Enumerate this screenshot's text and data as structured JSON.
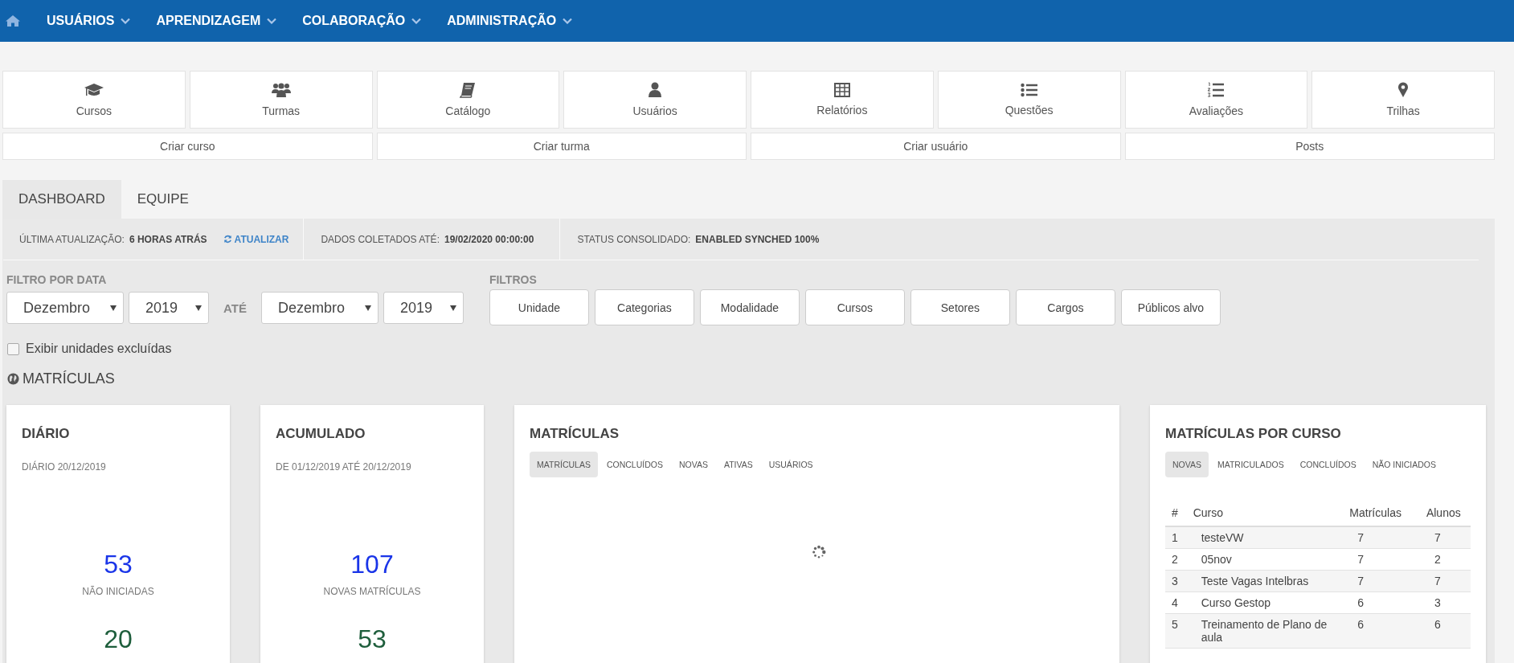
{
  "nav": {
    "items": [
      {
        "label": "USUÁRIOS"
      },
      {
        "label": "APRENDIZAGEM"
      },
      {
        "label": "COLABORAÇÃO"
      },
      {
        "label": "ADMINISTRAÇÃO"
      }
    ]
  },
  "shortcuts": [
    {
      "label": "Cursos"
    },
    {
      "label": "Turmas"
    },
    {
      "label": "Catálogo"
    },
    {
      "label": "Usuários"
    },
    {
      "label": "Relatórios"
    },
    {
      "label": "Questões"
    },
    {
      "label": "Avaliações"
    },
    {
      "label": "Trilhas"
    }
  ],
  "actions": [
    "Criar curso",
    "Criar turma",
    "Criar usuário",
    "Posts"
  ],
  "tabs": [
    {
      "label": "DASHBOARD",
      "selected": true
    },
    {
      "label": "EQUIPE",
      "selected": false
    }
  ],
  "info_bar": {
    "last_update": {
      "label": "ÚLTIMA ATUALIZAÇÃO:",
      "value": "6 HORAS ATRÁS",
      "action": "ATUALIZAR"
    },
    "collected": {
      "label": "DADOS COLETADOS ATÉ:",
      "value": "19/02/2020 00:00:00"
    },
    "status": {
      "label": "STATUS CONSOLIDADO:",
      "value": "ENABLED SYNCHED 100%"
    }
  },
  "date_filter": {
    "label": "FILTRO POR DATA",
    "from_month": "Dezembro",
    "from_year": "2019",
    "separator": "ATÉ",
    "to_month": "Dezembro",
    "to_year": "2019"
  },
  "filters": {
    "label": "FILTROS",
    "buttons": [
      "Unidade",
      "Categorias",
      "Modalidade",
      "Cursos",
      "Setores",
      "Cargos",
      "Públicos alvo"
    ]
  },
  "show_deleted": {
    "label": "Exibir unidades excluídas",
    "checked": false
  },
  "section_title": "MATRÍCULAS",
  "daily": {
    "title": "DIÁRIO",
    "subtitle": "DIÁRIO 20/12/2019",
    "metrics": [
      {
        "value": "53",
        "label": "NÃO INICIADAS",
        "color": "#1a35e8"
      },
      {
        "value": "20",
        "color": "#1e5e3c"
      }
    ]
  },
  "cumulative": {
    "title": "ACUMULADO",
    "subtitle": "DE 01/12/2019 ATÉ 20/12/2019",
    "metrics": [
      {
        "value": "107",
        "label": "NOVAS MATRÍCULAS",
        "color": "#1a35e8"
      },
      {
        "value": "53",
        "color": "#1e5e3c"
      }
    ]
  },
  "enrollments": {
    "title": "MATRÍCULAS",
    "loading": true,
    "tabs": [
      {
        "label": "MATRÍCULAS",
        "selected": true
      },
      {
        "label": "CONCLUÍDOS",
        "selected": false
      },
      {
        "label": "NOVAS",
        "selected": false
      },
      {
        "label": "ATIVAS",
        "selected": false
      },
      {
        "label": "USUÁRIOS",
        "selected": false
      }
    ]
  },
  "by_course": {
    "title": "MATRÍCULAS POR CURSO",
    "tabs": [
      {
        "label": "NOVAS",
        "selected": true
      },
      {
        "label": "MATRICULADOS",
        "selected": false
      },
      {
        "label": "CONCLUÍDOS",
        "selected": false
      },
      {
        "label": "NÃO INICIADOS",
        "selected": false
      }
    ],
    "table": {
      "columns": [
        "#",
        "Curso",
        "Matrículas",
        "Alunos"
      ],
      "rows": [
        [
          "1",
          "testeVW",
          "7",
          "7"
        ],
        [
          "2",
          "05nov",
          "7",
          "2"
        ],
        [
          "3",
          "Teste Vagas Intelbras",
          "7",
          "7"
        ],
        [
          "4",
          "Curso Gestop",
          "6",
          "3"
        ],
        [
          "5",
          "Treinamento de Plano de aula",
          "6",
          "6"
        ]
      ]
    }
  }
}
